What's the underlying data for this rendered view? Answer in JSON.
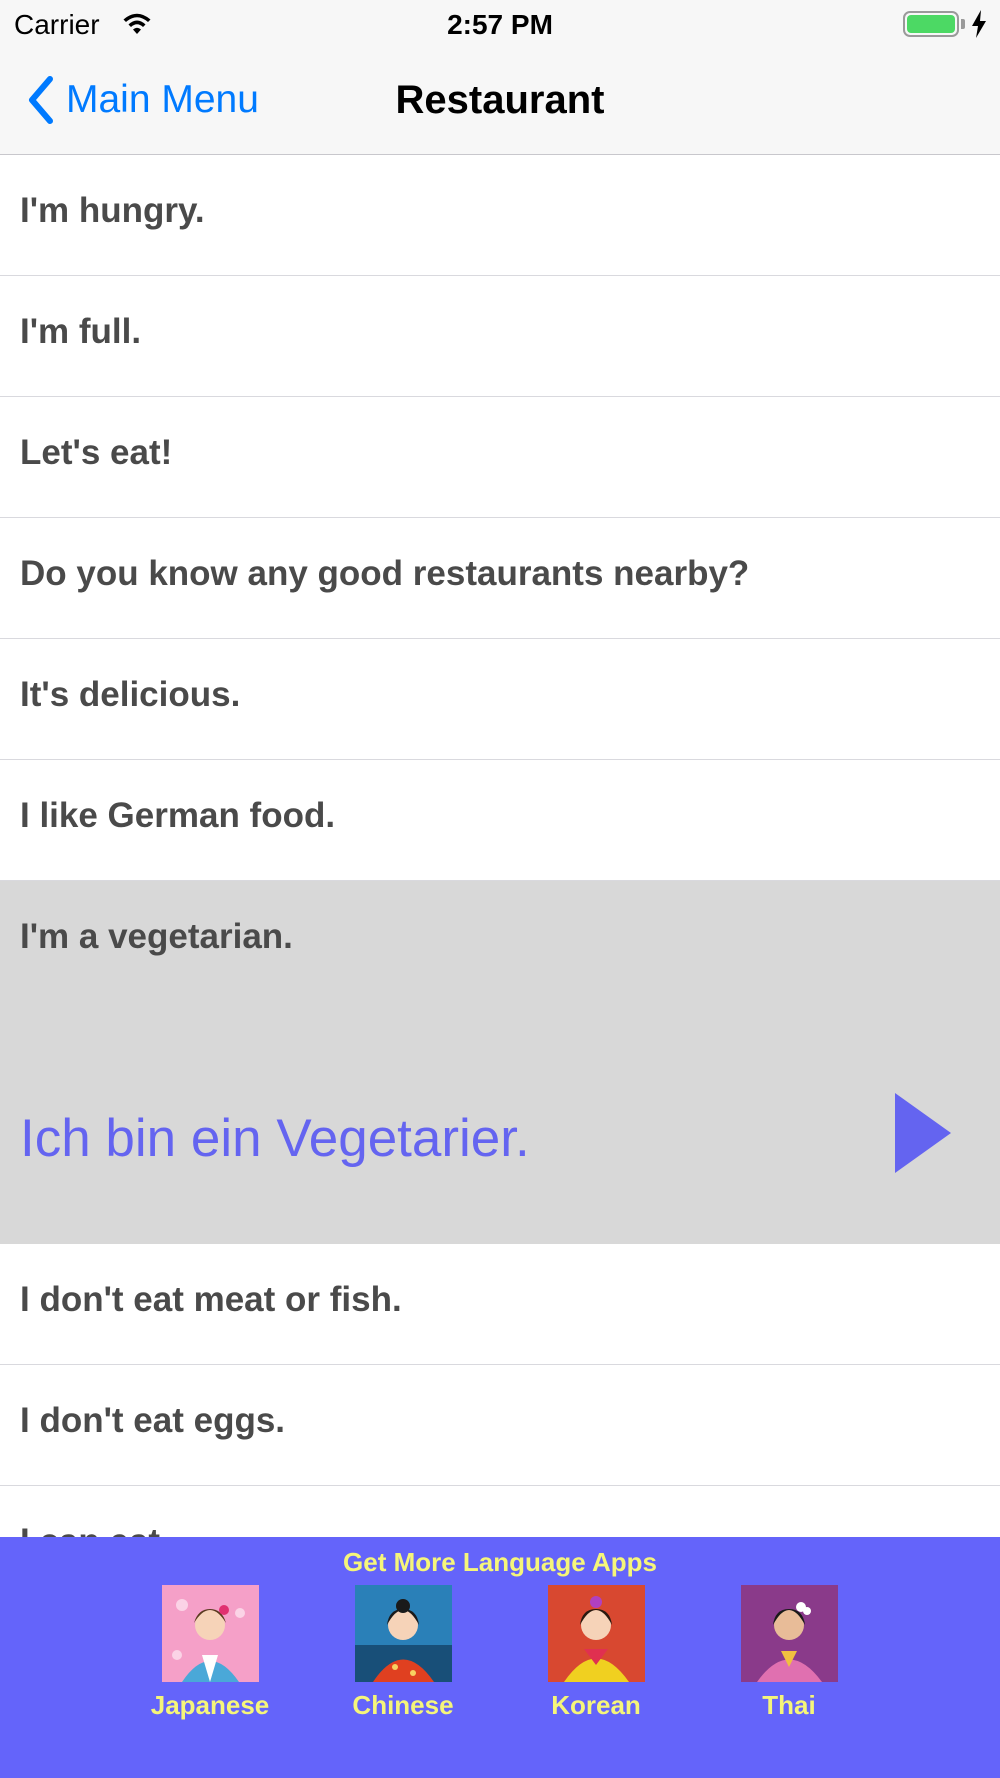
{
  "status_bar": {
    "carrier": "Carrier",
    "time": "2:57 PM",
    "icons": [
      "wifi-icon",
      "battery-icon",
      "charging-bolt-icon"
    ],
    "battery_color": "#4cd964"
  },
  "nav": {
    "back_label": "Main Menu",
    "title": "Restaurant",
    "accent_color": "#007aff"
  },
  "phrases": [
    "I'm hungry.",
    "I'm full.",
    "Let's eat!",
    "Do you know any good restaurants nearby?",
    "It's delicious.",
    "I like German food.",
    "I'm a vegetarian.",
    "I don't eat meat or fish.",
    "I don't eat eggs.",
    "I can eat ..."
  ],
  "selected": {
    "translation": "Ich bin ein Vegetarier.",
    "highlight_color": "#d8d8d8",
    "translation_color": "#6464f0",
    "play_icon": "play-icon"
  },
  "promo": {
    "title": "Get More Language Apps",
    "background_color": "#6464fa",
    "text_color": "#f5f57a",
    "apps": [
      {
        "label": "Japanese",
        "icon": "japanese-app-icon"
      },
      {
        "label": "Chinese",
        "icon": "chinese-app-icon"
      },
      {
        "label": "Korean",
        "icon": "korean-app-icon"
      },
      {
        "label": "Thai",
        "icon": "thai-app-icon"
      }
    ]
  }
}
